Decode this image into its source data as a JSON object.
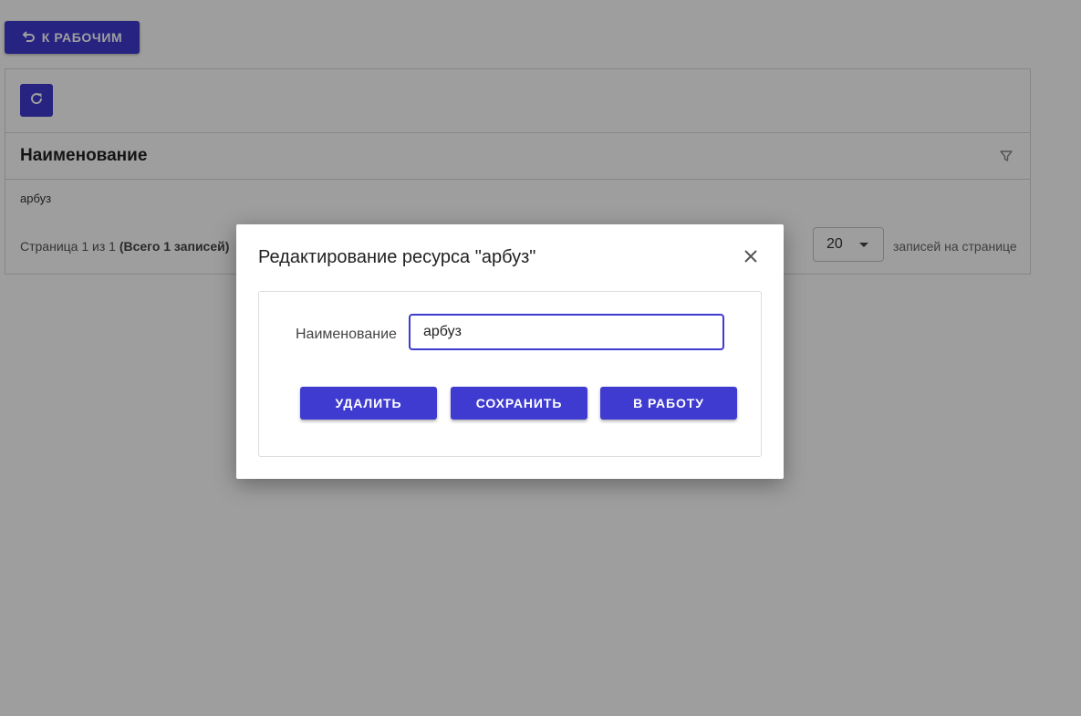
{
  "header": {
    "back_label": "К РАБОЧИМ"
  },
  "table": {
    "column_title": "Наименование",
    "rows": [
      {
        "name": "арбуз"
      }
    ],
    "pager": {
      "page_text": "Страница 1 из 1",
      "total_text": "(Всего 1 записей)",
      "page_size": "20",
      "per_page_label": "записей на странице"
    }
  },
  "dialog": {
    "title": "Редактирование ресурса \"арбуз\"",
    "field_label": "Наименование",
    "field_value": "арбуз",
    "buttons": {
      "delete": "УДАЛИТЬ",
      "save": "СОХРАНИТЬ",
      "to_work": "В РАБОТУ"
    }
  },
  "colors": {
    "accent": "#3f3bd0",
    "overlay": "rgba(0,0,0,0.38)"
  },
  "icons": {
    "back": "undo-arrow-icon",
    "refresh": "refresh-icon",
    "filter": "filter-icon",
    "close": "close-icon",
    "dropdown": "caret-down-icon"
  }
}
